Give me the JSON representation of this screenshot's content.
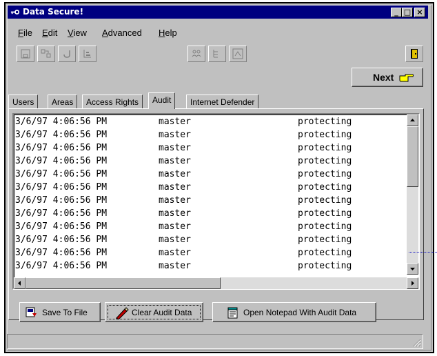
{
  "window": {
    "title": "Data Secure!"
  },
  "caption_buttons": {
    "minimize": "_",
    "maximize": "□",
    "close": "×"
  },
  "menu": [
    {
      "label": "File"
    },
    {
      "label": "Edit"
    },
    {
      "label": "View"
    },
    {
      "label": "Advanced"
    },
    {
      "label": "Help"
    }
  ],
  "toolbar": {
    "icons": [
      "save-disk-icon",
      "copy-arrows-icon",
      "undo-icon",
      "properties-icon",
      "users-icon",
      "tree-icon",
      "refresh-icon",
      "exit-door-icon"
    ]
  },
  "next_button": {
    "label": "Next"
  },
  "tabs": [
    {
      "label": "Users"
    },
    {
      "label": "Areas"
    },
    {
      "label": "Access Rights"
    },
    {
      "label": "Audit",
      "active": true
    },
    {
      "label": "Internet Defender"
    }
  ],
  "audit": {
    "rows": [
      {
        "date": "3/6/97 4:06:56 PM",
        "user": "master",
        "action": "protecting"
      },
      {
        "date": "3/6/97 4:06:56 PM",
        "user": "master",
        "action": "protecting"
      },
      {
        "date": "3/6/97 4:06:56 PM",
        "user": "master",
        "action": "protecting"
      },
      {
        "date": "3/6/97 4:06:56 PM",
        "user": "master",
        "action": "protecting"
      },
      {
        "date": "3/6/97 4:06:56 PM",
        "user": "master",
        "action": "protecting"
      },
      {
        "date": "3/6/97 4:06:56 PM",
        "user": "master",
        "action": "protecting"
      },
      {
        "date": "3/6/97 4:06:56 PM",
        "user": "master",
        "action": "protecting"
      },
      {
        "date": "3/6/97 4:06:56 PM",
        "user": "master",
        "action": "protecting"
      },
      {
        "date": "3/6/97 4:06:56 PM",
        "user": "master",
        "action": "protecting"
      },
      {
        "date": "3/6/97 4:06:56 PM",
        "user": "master",
        "action": "protecting"
      },
      {
        "date": "3/6/97 4:06:56 PM",
        "user": "master",
        "action": "protecting"
      },
      {
        "date": "3/6/97 4:06:56 PM",
        "user": "master",
        "action": "protecting"
      }
    ]
  },
  "actions": {
    "save_to_file": "Save To File",
    "clear_audit": "Clear Audit Data",
    "open_notepad": "Open Notepad With Audit Data"
  },
  "colors": {
    "titlebar": "#000080",
    "face": "#c0c0c0",
    "list_bg": "#ffffff"
  }
}
